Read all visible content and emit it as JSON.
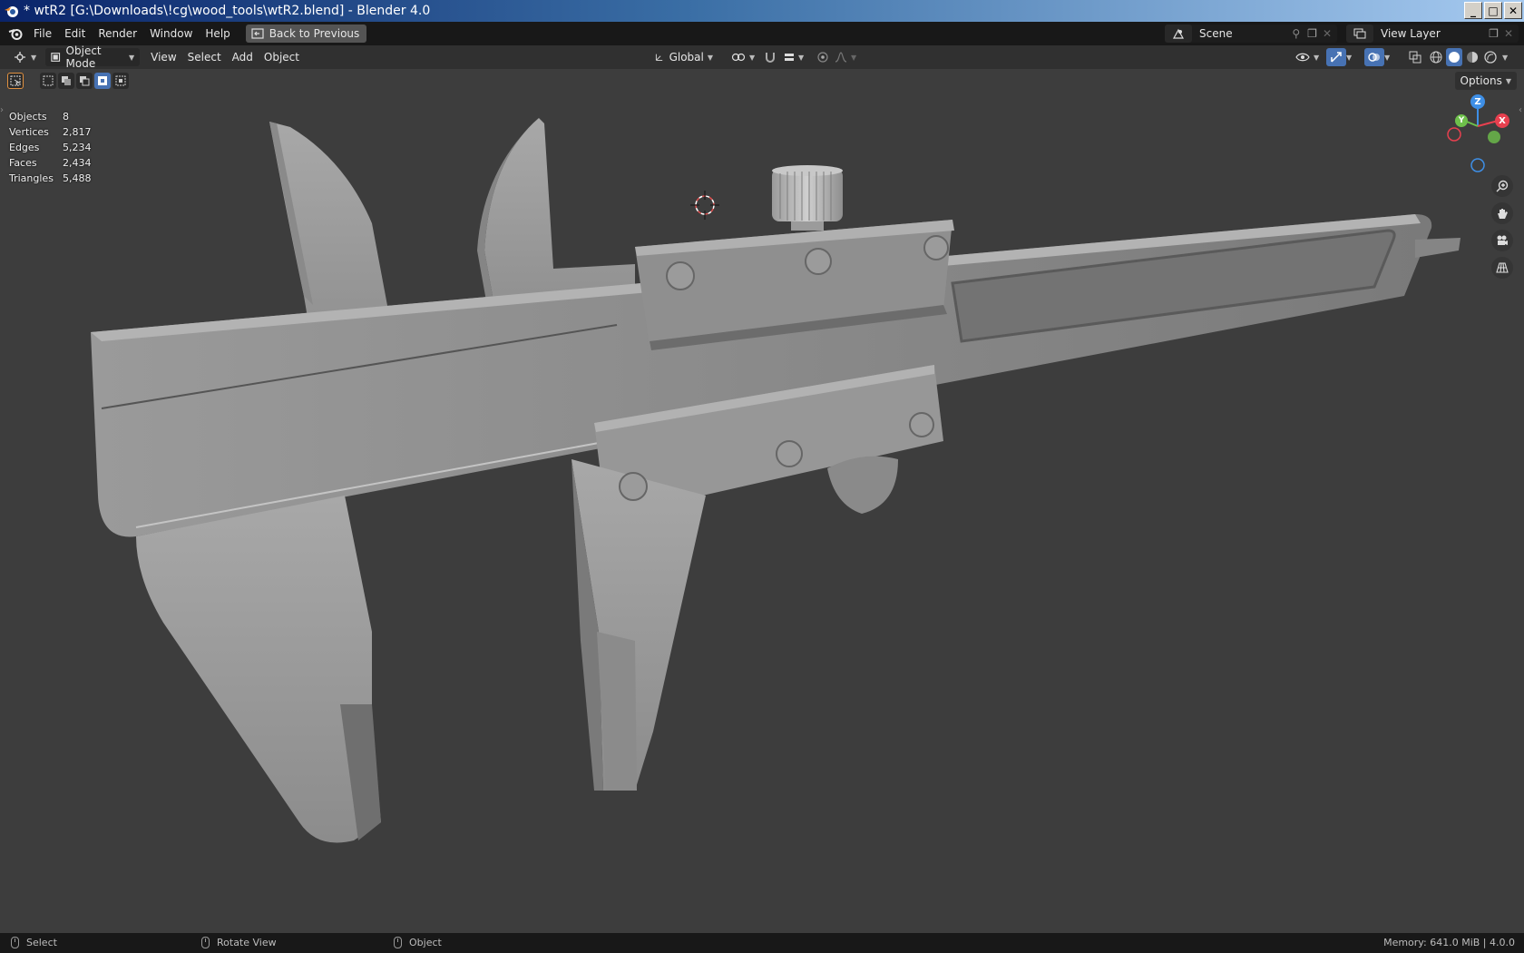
{
  "window": {
    "title": "* wtR2 [G:\\Downloads\\!cg\\wood_tools\\wtR2.blend] - Blender 4.0",
    "buttons": [
      "_",
      "□",
      "✕"
    ]
  },
  "topbar": {
    "menus": [
      "File",
      "Edit",
      "Render",
      "Window",
      "Help"
    ],
    "back_button": "Back to Previous",
    "scene_name": "Scene",
    "view_layer_name": "View Layer"
  },
  "viewport_header": {
    "mode": "Object Mode",
    "menus": [
      "View",
      "Select",
      "Add",
      "Object"
    ],
    "transform_orientation": "Global",
    "options_label": "Options"
  },
  "stats": [
    {
      "label": "Objects",
      "value": "8"
    },
    {
      "label": "Vertices",
      "value": "2,817"
    },
    {
      "label": "Edges",
      "value": "5,234"
    },
    {
      "label": "Faces",
      "value": "2,434"
    },
    {
      "label": "Triangles",
      "value": "5,488"
    }
  ],
  "gizmo": {
    "x": "X",
    "y": "Y",
    "z": "Z"
  },
  "statusbar": {
    "left_action": "Select",
    "middle_action": "Rotate View",
    "right_action": "Object",
    "memory": "Memory: 641.0 MiB | 4.0.0"
  },
  "colors": {
    "viewport_bg": "#3d3d3d",
    "header_bg": "#303030",
    "topbar_bg": "#181818",
    "accent": "#4772b3",
    "axis_x": "#e8404f",
    "axis_y": "#6ec04b",
    "axis_z": "#3e8fe6"
  }
}
